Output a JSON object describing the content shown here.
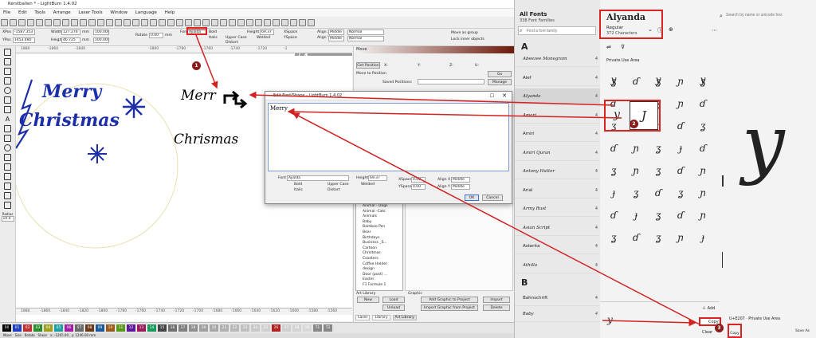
{
  "lightburn": {
    "title": "Kerstballen * - LightBurn 1.4.02",
    "menu": [
      "File",
      "Edit",
      "Tools",
      "Arrange",
      "Laser Tools",
      "Window",
      "Language",
      "Help"
    ],
    "font_field": "Ayalda",
    "height_label": "Height",
    "height_value": "69.37",
    "upper_case": "Upper Case",
    "welded": "Welded",
    "distort": "Distort",
    "bold": "Bold",
    "italic": "Italic",
    "xspace_label": "XSpace",
    "yspace_label": "YSpace",
    "xspace_value": "0.00",
    "align_x": "Align X",
    "align_y": "Align Y",
    "middle": "Middle",
    "normal": "Normal",
    "move_as_group": "Move as group",
    "lock_inner_objects": "Lock inner objects",
    "xpos_label": "XPos",
    "xpos_value": "-1587.353",
    "ypos_label": "YPos",
    "ypos_value": "1453.480",
    "width_label": "Width",
    "width_value": "127.276",
    "height_value2": "46.725",
    "mm": "mm",
    "pct": "100.000",
    "rotate": "Rotate",
    "rotate_value": "0.00",
    "font_label": "Font",
    "ruler_top": [
      "1880",
      "-1860",
      "-1840",
      "-1800",
      "-1780",
      "-1760",
      "-1740",
      "-1720",
      "-1"
    ],
    "ruler_bottom": [
      "1880",
      "-1860",
      "-1840",
      "-1820",
      "-1800",
      "-1780",
      "-1760",
      "-1740",
      "-1720",
      "-1700",
      "-1680",
      "-1660",
      "-1640",
      "-1620",
      "-1600",
      "-1580",
      "-1560",
      "-1540",
      "-1520"
    ],
    "ruler_left": [
      "1880",
      "1460",
      "1440",
      "1420",
      "1400",
      "1380",
      "1360",
      "1340",
      "1320",
      "1300",
      "1280",
      "1260",
      "1240",
      "1220",
      "1200",
      "1180",
      "1160"
    ],
    "ruler_right": [
      "1520",
      "1500",
      "1480",
      "1440",
      "1420",
      "1400",
      "1380",
      "1280",
      "1260",
      "1240",
      "1220",
      "1200",
      "1180",
      "1160",
      "1140",
      "1120"
    ],
    "left_ruler_bottom": [
      "Radius",
      "10.0"
    ],
    "canvas_text": {
      "merry": "Merry",
      "christmas": "Christmas",
      "merr": "Merr",
      "chrismas": "Chrismas",
      "page": "1 / 4"
    },
    "move_panel": {
      "title": "Move",
      "get_position": "Get Position",
      "move_to_position": "Move to Position",
      "saved_positions": "Saved Positions:",
      "x": "X:",
      "y": "Y:",
      "z": "Z:",
      "u": "U:",
      "go": "Go",
      "manage": "Manage"
    },
    "art_library": {
      "list": [
        "Animal - Dogs",
        "Animal -Cats",
        "Animals",
        "Baby",
        "Bamboo Pen",
        "Bear",
        "Birthdays",
        "Business _S...",
        "Cartoon",
        "Christmas",
        "Coasters",
        "Coffee Holder",
        "design",
        "Door (post) ...",
        "Easter",
        "F1 Formule 1"
      ],
      "header": "Art Library",
      "graphic_header": "Graphic",
      "new": "New",
      "load": "Load",
      "unload": "Unload",
      "import_graphic": "Add Graphic to Project",
      "import_graphic_from": "Import Graphic from Project",
      "import": "Import",
      "delete": "Delete",
      "tabs": [
        "Laser",
        "Library",
        "Art Library"
      ]
    },
    "palette": [
      "00",
      "01",
      "02",
      "03",
      "04",
      "05",
      "06",
      "07",
      "08",
      "09",
      "10",
      "11",
      "12",
      "13",
      "14",
      "15",
      "16",
      "17",
      "18",
      "19",
      "20",
      "21",
      "22",
      "23",
      "24",
      "25",
      "26",
      "27",
      "28",
      "29",
      "T1",
      "T2"
    ],
    "palette_colors": [
      "#000000",
      "#1f3fbf",
      "#c03030",
      "#2e8b2e",
      "#a0a020",
      "#20a0a0",
      "#a020a0",
      "#6a6a6a",
      "#6a3a1a",
      "#1a5a9a",
      "#9a5a1a",
      "#5a9a1a",
      "#5a1a9a",
      "#9a1a5a",
      "#1a9a5a",
      "#444444",
      "#707070",
      "#808080",
      "#909090",
      "#a0a0a0",
      "#a8a8a8",
      "#b0b0b0",
      "#b8b8b8",
      "#c0c0c0",
      "#c8c8c8",
      "#d0d0d0",
      "#b22222",
      "#d0d0d0",
      "#d4d4d4",
      "#d8d8d8",
      "#888888",
      "#888888"
    ],
    "statusbar": [
      "Move",
      "Size",
      "Rotate",
      "Shear",
      "x: -1265.00 , y: 1246.00 mm"
    ]
  },
  "dialog": {
    "title": "Edit Font/Shape - LightBurn 1.4.02",
    "text": "Merr\u0000",
    "text_display": "Merry",
    "font_label": "Font",
    "font_value": "Ayalda",
    "height_label": "Height",
    "height_value": "69.37",
    "bold": "Bold",
    "italic": "Italic",
    "upper_case": "Upper Case",
    "distort": "Distort",
    "welded": "Welded",
    "xspace_label": "XSpace",
    "xspace_value": "0.00",
    "yspace_label": "YSpace",
    "yspace_value": "0.00",
    "align_x_label": "Align X",
    "align_x_value": "Middle",
    "align_y_label": "Align Y",
    "align_y_value": "Middle",
    "ok": "OK",
    "cancel": "Cancel"
  },
  "charmap": {
    "all_fonts": "All Fonts",
    "family_count": "338 Font Families",
    "find_placeholder": "Find a font family",
    "section_a": "A",
    "section_b": "B",
    "fonts": [
      {
        "name": "Abeezee Monogram",
        "count": "4"
      },
      {
        "name": "Alef",
        "count": "4"
      },
      {
        "name": "Alyanda",
        "count": "4"
      },
      {
        "name": "Amari",
        "count": "4"
      },
      {
        "name": "Amiri",
        "count": "4"
      },
      {
        "name": "Amiri Quran",
        "count": "4"
      },
      {
        "name": "Antony Hutter",
        "count": "4"
      },
      {
        "name": "Arial",
        "count": "4"
      },
      {
        "name": "Army Rust",
        "count": "4"
      },
      {
        "name": "Asian Script",
        "count": "4"
      },
      {
        "name": "Asterita",
        "count": "4"
      },
      {
        "name": "Athilla",
        "count": "4"
      }
    ],
    "fonts_b": [
      {
        "name": "Bahnschrift",
        "count": "4"
      },
      {
        "name": "Baby",
        "count": "4"
      }
    ],
    "font_title": "Alyanda",
    "style": "Regular",
    "char_count": "372 Characters",
    "search_placeholder": "Search by name or unicode hex",
    "section": "Private Use Area",
    "big_glyph": "y",
    "add": "Add",
    "copy": "Copy",
    "clear": "Clear",
    "copy_btn": "Copy",
    "save_as": "Save As",
    "unicode_info": "U+E207 · Private Use Area",
    "glyphs": [
      "y",
      "J",
      "y",
      "y",
      "y",
      "y",
      "y",
      "y",
      "y",
      "y",
      "y",
      "y",
      "y",
      "y",
      "y",
      "y",
      "y",
      "y",
      "y",
      "y",
      "y",
      "y",
      "y",
      "y",
      "y",
      "y",
      "y",
      "y",
      "y",
      "y",
      "y",
      "y",
      "y",
      "y",
      "y",
      "y",
      "y",
      "y",
      "y",
      "y",
      "y",
      "y",
      "y",
      "y"
    ],
    "grid_glyphs": [
      "ʓ",
      "ɗ",
      "ʓ",
      "ɲ",
      "ʓ",
      "ɗ",
      "ɟ",
      "ʓ",
      "ɲ",
      "ɗ",
      "ʓ",
      "ɟ",
      "ɲ",
      "ɗ",
      "ʓ",
      "ɗ",
      "ɲ",
      "ʓ",
      "ɟ",
      "ɗ",
      "ʓ",
      "ɲ",
      "ʓ",
      "ɗ",
      "ɲ",
      "ɟ",
      "ʓ",
      "ɗ",
      "ʓ",
      "ɲ",
      "ɗ",
      "ɟ",
      "ʓ",
      "ɗ",
      "ɲ",
      "ʓ",
      "ɗ",
      "ʓ",
      "ɲ",
      "ɟ"
    ]
  },
  "annotations": {
    "badge1": "1",
    "badge2": "2",
    "badge3": "3",
    "arrow_color": "#d22222",
    "accent": "#1c2fa8"
  }
}
